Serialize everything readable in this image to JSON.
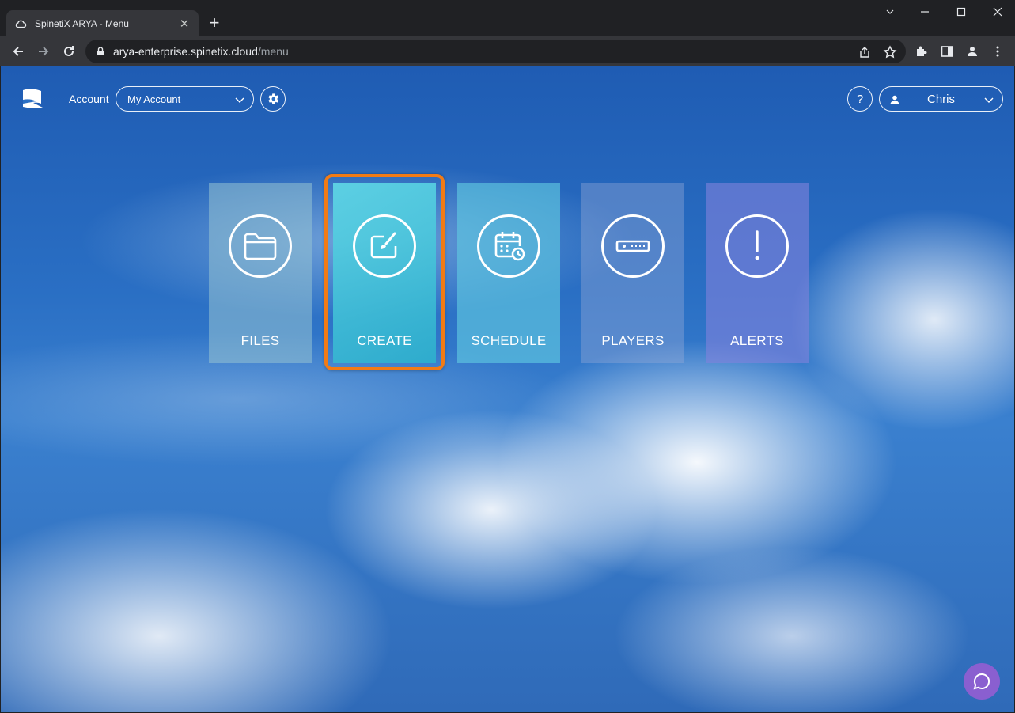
{
  "browser": {
    "tab_title": "SpinetiX ARYA - Menu",
    "tab_close": "✕",
    "new_tab": "+",
    "url_host": "arya-enterprise.spinetix.cloud",
    "url_path": "/menu"
  },
  "header": {
    "account_label": "Account",
    "account_select_value": "My Account",
    "help_label": "?",
    "user_name": "Chris"
  },
  "tiles": [
    {
      "label": "FILES",
      "icon": "folder-icon"
    },
    {
      "label": "CREATE",
      "icon": "edit-brush-icon"
    },
    {
      "label": "SCHEDULE",
      "icon": "calendar-clock-icon"
    },
    {
      "label": "PLAYERS",
      "icon": "player-device-icon"
    },
    {
      "label": "ALERTS",
      "icon": "exclamation-icon"
    }
  ],
  "colors": {
    "highlight": "#f27b15",
    "chat_button": "#8a5fd0"
  }
}
